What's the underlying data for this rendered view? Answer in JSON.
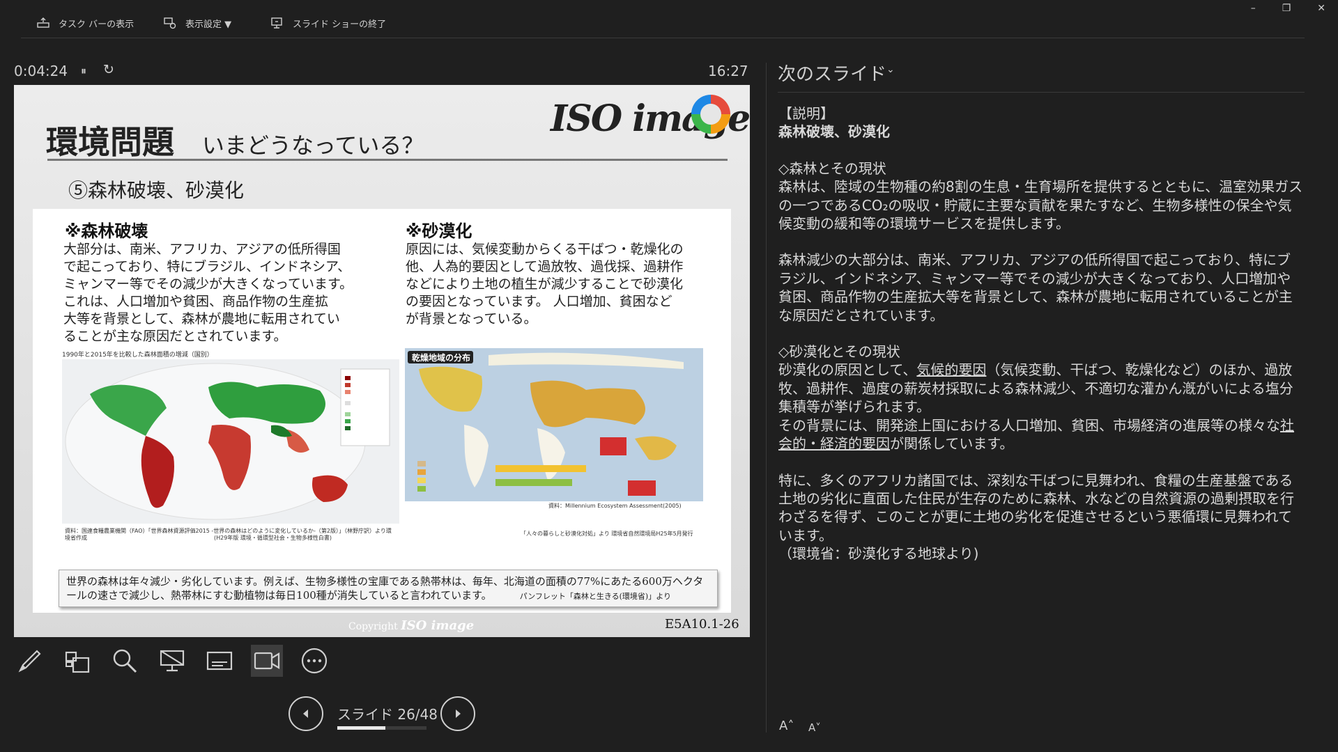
{
  "toolbar": {
    "taskbar_label": "タスク バーの表示",
    "display_settings_label": "表示設定 ▼",
    "end_show_label": "スライド ショーの終了"
  },
  "window": {
    "minimize": "–",
    "restore": "❐",
    "close": "✕"
  },
  "presenter": {
    "elapsed": "0:04:24",
    "clock": "16:27",
    "pause_icon": "⏸",
    "reset_icon": "↻"
  },
  "slide": {
    "title": "環境問題",
    "subtitle": "いまどうなっている？",
    "logo_text": "ISO image",
    "heading": "⑤森林破壊、砂漠化",
    "left_heading": "※森林破壊",
    "left_text": [
      "大部分は、南米、アフリカ、アジアの低所得国",
      "で起こっており、特にブラジル、インドネシア、",
      "ミャンマー等でその減少が大きくなっています。",
      "これは、人口増加や貧困、商品作物の生産拡",
      "大等を背景として、森林が農地に転用されてい",
      "ることが主な原因だとされています。"
    ],
    "right_heading": "※砂漠化",
    "right_text": [
      "原因には、気候変動からくる干ばつ・乾燥化の",
      "他、人為的要因として過放牧、過伐採、過耕作",
      "などにより土地の植生が減少することで砂漠化",
      "の要因となっています。 人口増加、貧困など",
      "が背景となっている。"
    ],
    "left_map_caption": "1990年と2015年を比較した森林面積の増減（国別）",
    "left_map_source": "資料：国連食糧農業機関（FAO）「世界森林資源評価2015 -世界の森林はどのように変化しているか-（第2版）」（林野庁訳）より環境省作成",
    "left_map_source2": "(H29年版 環境・循環型社会・生物多様性白書)",
    "right_map_label": "乾燥地域の分布",
    "right_map_source": "資料：Millennium Ecosystem Assessment(2005)",
    "right_map_source2": "「人々の暮らしと砂漠化対処」より 環境省自然環境局H25年5月発行",
    "note_text": "世界の森林は年々減少・劣化しています。例えば、生物多様性の宝庫である熱帯林は、毎年、北海道の面積の77%にあたる600万ヘクタールの速さで減少し、熱帯林にすむ動植物は毎日100種が消失していると言われています。",
    "note_source": "パンフレット「森林と生きる(環境省)」より",
    "copyright_label": "Copyright",
    "copyright_logo": "ISO image",
    "code": "E5A10.1-26"
  },
  "tools": [
    "pen-icon",
    "gallery-icon",
    "zoom-icon",
    "black-screen-icon",
    "subtitles-icon",
    "camera-icon",
    "more-icon"
  ],
  "navigation": {
    "counter": "スライド 26/48",
    "progress": 0.5417
  },
  "notes_panel": {
    "title": "次のスライド",
    "caret": "⌄",
    "p1": "【説明】",
    "p2": "森林破壊、砂漠化",
    "p3": "◇森林とその現状",
    "p4": "森林は、陸域の生物種の約8割の生息・生育場所を提供するとともに、温室効果ガスの一つであるCO₂の吸収・貯蔵に主要な貢献を果たすなど、生物多様性の保全や気候変動の緩和等の環境サービスを提供します。",
    "p5": "森林減少の大部分は、南米、アフリカ、アジアの低所得国で起こっており、特にブラジル、インドネシア、ミャンマー等でその減少が大きくなっており、人口増加や貧困、商品作物の生産拡大等を背景として、森林が農地に転用されていることが主な原因だとされています。",
    "p6": "◇砂漠化とその現状",
    "p7a": "砂漠化の原因として、",
    "p7u": "気候的要因",
    "p7b": "（気候変動、干ばつ、乾燥化など）のほか、過放牧、過耕作、過度の薪炭材採取による森林減少、不適切な灌かん漑がいによる塩分集積等が挙げられます。",
    "p8a": "その背景には、開発途上国における人口増加、貧困、市場経済の進展等の様々な",
    "p8u": "社会的・経済的要因",
    "p8b": "が関係しています。",
    "p9": "特に、多くのアフリカ諸国では、深刻な干ばつに見舞われ、食糧の生産基盤である土地の劣化に直面した住民が生存のために森林、水などの自然資源の過剰摂取を行わざるを得ず、このことが更に土地の劣化を促進させるという悪循環に見舞われています。",
    "p10": "（環境省：砂漠化する地球より)",
    "font_up": "A˄",
    "font_down": "A˅"
  }
}
